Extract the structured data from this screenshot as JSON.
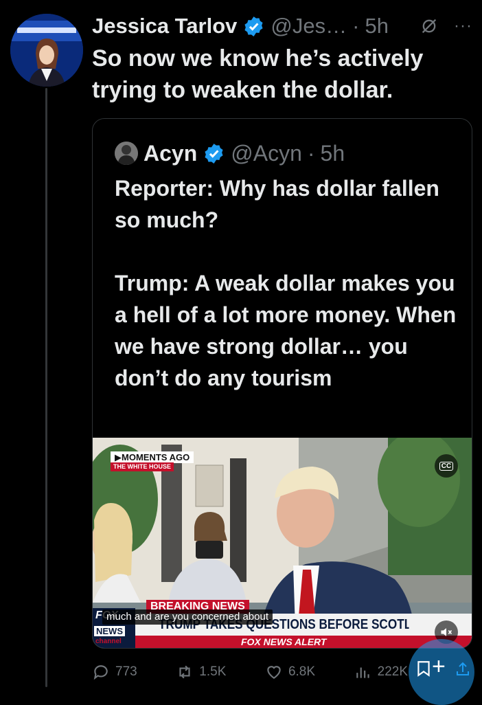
{
  "tweet": {
    "display_name": "Jessica Tarlov",
    "handle": "@Jes…",
    "separator": "·",
    "time": "5h",
    "text": "So now we know he’s actively trying to weaken the dollar.",
    "more_label": "···"
  },
  "quoted_tweet": {
    "display_name": "Acyn",
    "handle": "@Acyn",
    "separator": "·",
    "time": "5h",
    "text": "Reporter: Why has dollar fallen so much?\n\nTrump: A weak dollar makes you a hell of a lot more money. When we have strong dollar… you don’t do any tourism",
    "video": {
      "moments_label": "▶MOMENTS AGO",
      "location_label": "THE WHITE HOUSE",
      "cc_label": "CC",
      "breaking_label": "BREAKING NEWS",
      "chyron": "TRUMP TAKES QUESTIONS BEFORE SCOTLAND DEPARTURE",
      "alert_label": "FOX NEWS ALERT",
      "caption": "much and are you concerned about",
      "logo_top": "FOX",
      "logo_mid": "NEWS",
      "logo_bottom": "channel"
    }
  },
  "actions": {
    "replies": "773",
    "reposts": "1.5K",
    "likes": "6.8K",
    "views": "222K"
  },
  "colors": {
    "verified": "#1d9bf0",
    "muted": "#71767b",
    "text": "#e7e9ea",
    "fox_red": "#c4102b"
  },
  "icons": [
    "verified-badge-icon",
    "muted-bell-icon",
    "more-icon",
    "cc-icon",
    "volume-muted-icon",
    "reply-icon",
    "repost-icon",
    "like-icon",
    "views-icon",
    "bookmark-icon",
    "plus-icon",
    "share-icon"
  ]
}
